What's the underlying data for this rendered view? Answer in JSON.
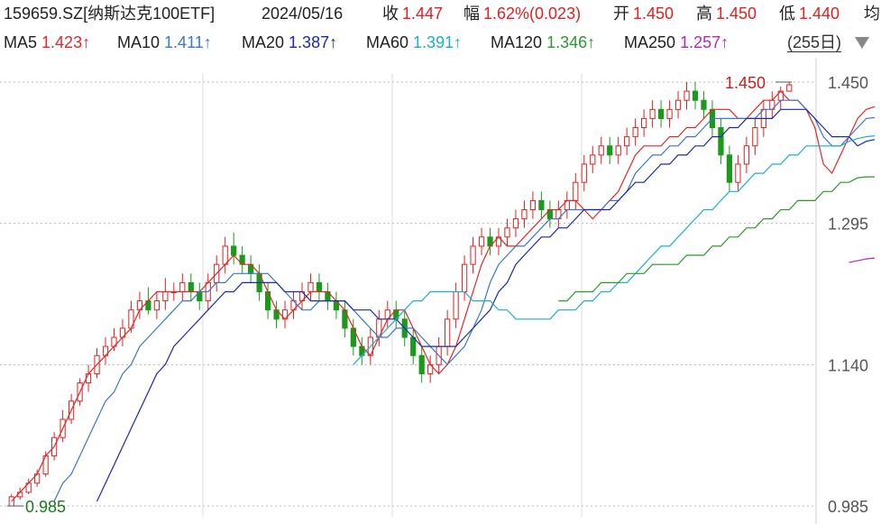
{
  "header": {
    "code": "159659.SZ[纳斯达克100ETF]",
    "date": "2024/05/16",
    "close_label": "收",
    "close_value": "1.447",
    "change_label": "幅",
    "change_value": "1.62%(0.023)",
    "open_label": "开",
    "open_value": "1.450",
    "high_label": "高",
    "high_value": "1.450",
    "low_label": "低",
    "low_value": "1.440",
    "avg_label": "均"
  },
  "ma_legend": [
    {
      "label": "MA5",
      "value": "1.423",
      "arrow": "↑",
      "color": "#e02828"
    },
    {
      "label": "MA10",
      "value": "1.411",
      "arrow": "↑",
      "color": "#3a78c8"
    },
    {
      "label": "MA20",
      "value": "1.387",
      "arrow": "↑",
      "color": "#1a2aa8"
    },
    {
      "label": "MA60",
      "value": "1.391",
      "arrow": "↑",
      "color": "#1ab0c8"
    },
    {
      "label": "MA120",
      "value": "1.346",
      "arrow": "↑",
      "color": "#2a9a2a"
    },
    {
      "label": "MA250",
      "value": "1.257",
      "arrow": "↑",
      "color": "#b02ab0"
    }
  ],
  "period_label": "(255日)",
  "colors": {
    "up": "#e02020",
    "down": "#1a9a1a",
    "grid": "#b8b8b8"
  },
  "chart_data": {
    "type": "candlestick",
    "y_ticks": [
      "1.450",
      "1.295",
      "1.140",
      "0.985"
    ],
    "ylim": [
      0.985,
      1.45
    ],
    "max_label": "1.450",
    "min_label": "0.985",
    "series": [
      {
        "name": "MA5",
        "values": [
          0.99,
          1.0,
          1.01,
          1.02,
          1.04,
          1.05,
          1.07,
          1.09,
          1.11,
          1.13,
          1.14,
          1.15,
          1.16,
          1.17,
          1.18,
          1.2,
          1.21,
          1.22,
          1.22,
          1.22,
          1.22,
          1.22,
          1.22,
          1.23,
          1.24,
          1.25,
          1.26,
          1.25,
          1.25,
          1.24,
          1.22,
          1.2,
          1.19,
          1.2,
          1.21,
          1.22,
          1.22,
          1.22,
          1.21,
          1.2,
          1.18,
          1.16,
          1.15,
          1.17,
          1.19,
          1.2,
          1.2,
          1.18,
          1.16,
          1.14,
          1.13,
          1.14,
          1.16,
          1.19,
          1.22,
          1.25,
          1.27,
          1.28,
          1.27,
          1.27,
          1.28,
          1.29,
          1.3,
          1.31,
          1.31,
          1.32,
          1.32,
          1.31,
          1.3,
          1.31,
          1.32,
          1.33,
          1.35,
          1.37,
          1.38,
          1.38,
          1.38,
          1.39,
          1.39,
          1.4,
          1.4,
          1.41,
          1.42,
          1.42,
          1.42,
          1.41,
          1.41,
          1.42,
          1.43,
          1.43,
          1.44,
          1.43,
          1.43,
          1.42,
          1.4,
          1.36,
          1.35,
          1.37,
          1.39,
          1.41,
          1.42,
          1.423
        ]
      },
      {
        "name": "MA10",
        "values": [
          null,
          null,
          null,
          null,
          null,
          0.99,
          1.01,
          1.02,
          1.04,
          1.06,
          1.08,
          1.1,
          1.11,
          1.13,
          1.14,
          1.16,
          1.17,
          1.18,
          1.19,
          1.2,
          1.21,
          1.21,
          1.22,
          1.22,
          1.23,
          1.23,
          1.24,
          1.24,
          1.24,
          1.24,
          1.24,
          1.23,
          1.22,
          1.21,
          1.2,
          1.2,
          1.21,
          1.21,
          1.21,
          1.21,
          1.2,
          1.19,
          1.18,
          1.17,
          1.17,
          1.18,
          1.18,
          1.18,
          1.17,
          1.16,
          1.15,
          1.14,
          1.15,
          1.16,
          1.18,
          1.2,
          1.23,
          1.25,
          1.26,
          1.27,
          1.27,
          1.28,
          1.29,
          1.3,
          1.3,
          1.31,
          1.31,
          1.31,
          1.31,
          1.31,
          1.32,
          1.32,
          1.33,
          1.35,
          1.36,
          1.37,
          1.37,
          1.38,
          1.38,
          1.39,
          1.39,
          1.4,
          1.41,
          1.41,
          1.41,
          1.41,
          1.41,
          1.41,
          1.42,
          1.42,
          1.43,
          1.43,
          1.43,
          1.42,
          1.41,
          1.39,
          1.38,
          1.38,
          1.39,
          1.4,
          1.41,
          1.411
        ]
      },
      {
        "name": "MA20",
        "values": [
          null,
          null,
          null,
          null,
          null,
          null,
          null,
          null,
          null,
          null,
          0.99,
          1.01,
          1.03,
          1.05,
          1.07,
          1.09,
          1.11,
          1.13,
          1.14,
          1.16,
          1.17,
          1.18,
          1.19,
          1.2,
          1.21,
          1.22,
          1.22,
          1.23,
          1.23,
          1.23,
          1.23,
          1.23,
          1.22,
          1.22,
          1.22,
          1.21,
          1.21,
          1.21,
          1.21,
          1.21,
          1.2,
          1.2,
          1.2,
          1.19,
          1.19,
          1.19,
          1.18,
          1.17,
          1.16,
          1.16,
          1.16,
          1.16,
          1.16,
          1.17,
          1.18,
          1.19,
          1.2,
          1.22,
          1.23,
          1.25,
          1.26,
          1.27,
          1.28,
          1.28,
          1.29,
          1.29,
          1.3,
          1.31,
          1.31,
          1.31,
          1.31,
          1.32,
          1.33,
          1.34,
          1.34,
          1.35,
          1.36,
          1.36,
          1.37,
          1.37,
          1.38,
          1.38,
          1.39,
          1.39,
          1.4,
          1.4,
          1.41,
          1.41,
          1.41,
          1.41,
          1.42,
          1.42,
          1.42,
          1.42,
          1.41,
          1.4,
          1.39,
          1.39,
          1.39,
          1.38,
          1.385,
          1.387
        ]
      },
      {
        "name": "MA60",
        "values": [
          null,
          null,
          null,
          null,
          null,
          null,
          null,
          null,
          null,
          null,
          null,
          null,
          null,
          null,
          null,
          null,
          null,
          null,
          null,
          null,
          null,
          null,
          null,
          null,
          null,
          null,
          null,
          null,
          null,
          null,
          null,
          null,
          null,
          null,
          null,
          null,
          null,
          null,
          null,
          null,
          1.14,
          1.15,
          1.16,
          1.17,
          1.18,
          1.19,
          1.2,
          1.21,
          1.21,
          1.22,
          1.22,
          1.22,
          1.22,
          1.22,
          1.21,
          1.21,
          1.21,
          1.2,
          1.2,
          1.19,
          1.19,
          1.19,
          1.19,
          1.19,
          1.2,
          1.2,
          1.2,
          1.21,
          1.21,
          1.22,
          1.22,
          1.23,
          1.23,
          1.24,
          1.25,
          1.26,
          1.27,
          1.27,
          1.28,
          1.29,
          1.3,
          1.31,
          1.31,
          1.32,
          1.33,
          1.33,
          1.34,
          1.35,
          1.35,
          1.36,
          1.36,
          1.37,
          1.37,
          1.38,
          1.38,
          1.38,
          1.38,
          1.38,
          1.385,
          1.388,
          1.39,
          1.391
        ]
      },
      {
        "name": "MA120",
        "values": [
          null,
          null,
          null,
          null,
          null,
          null,
          null,
          null,
          null,
          null,
          null,
          null,
          null,
          null,
          null,
          null,
          null,
          null,
          null,
          null,
          null,
          null,
          null,
          null,
          null,
          null,
          null,
          null,
          null,
          null,
          null,
          null,
          null,
          null,
          null,
          null,
          null,
          null,
          null,
          null,
          null,
          null,
          null,
          null,
          null,
          null,
          null,
          null,
          null,
          null,
          null,
          null,
          null,
          null,
          null,
          null,
          null,
          null,
          null,
          null,
          null,
          null,
          null,
          null,
          1.21,
          1.21,
          1.22,
          1.22,
          1.22,
          1.23,
          1.23,
          1.23,
          1.24,
          1.24,
          1.24,
          1.25,
          1.25,
          1.25,
          1.25,
          1.26,
          1.26,
          1.26,
          1.27,
          1.27,
          1.28,
          1.28,
          1.29,
          1.29,
          1.3,
          1.3,
          1.31,
          1.31,
          1.32,
          1.32,
          1.32,
          1.33,
          1.33,
          1.34,
          1.34,
          1.345,
          1.346,
          1.346
        ]
      },
      {
        "name": "MA250",
        "values": [
          null,
          null,
          null,
          null,
          null,
          null,
          null,
          null,
          null,
          null,
          null,
          null,
          null,
          null,
          null,
          null,
          null,
          null,
          null,
          null,
          null,
          null,
          null,
          null,
          null,
          null,
          null,
          null,
          null,
          null,
          null,
          null,
          null,
          null,
          null,
          null,
          null,
          null,
          null,
          null,
          null,
          null,
          null,
          null,
          null,
          null,
          null,
          null,
          null,
          null,
          null,
          null,
          null,
          null,
          null,
          null,
          null,
          null,
          null,
          null,
          null,
          null,
          null,
          null,
          null,
          null,
          null,
          null,
          null,
          null,
          null,
          null,
          null,
          null,
          null,
          null,
          null,
          null,
          null,
          null,
          null,
          null,
          null,
          null,
          null,
          null,
          null,
          null,
          null,
          null,
          null,
          null,
          null,
          null,
          null,
          null,
          null,
          null,
          1.252,
          1.254,
          1.256,
          1.257
        ]
      }
    ],
    "candles": [
      [
        0.985,
        0.995,
        0.985,
        0.998
      ],
      [
        0.995,
        1.0,
        0.992,
        1.005
      ],
      [
        1.0,
        1.01,
        0.998,
        1.015
      ],
      [
        1.01,
        1.02,
        1.006,
        1.025
      ],
      [
        1.02,
        1.04,
        1.017,
        1.045
      ],
      [
        1.04,
        1.06,
        1.035,
        1.066
      ],
      [
        1.06,
        1.08,
        1.055,
        1.09
      ],
      [
        1.08,
        1.1,
        1.075,
        1.108
      ],
      [
        1.1,
        1.12,
        1.095,
        1.125
      ],
      [
        1.12,
        1.13,
        1.11,
        1.14
      ],
      [
        1.13,
        1.15,
        1.125,
        1.158
      ],
      [
        1.15,
        1.16,
        1.14,
        1.17
      ],
      [
        1.16,
        1.17,
        1.155,
        1.18
      ],
      [
        1.17,
        1.18,
        1.16,
        1.19
      ],
      [
        1.18,
        1.2,
        1.175,
        1.21
      ],
      [
        1.2,
        1.21,
        1.19,
        1.22
      ],
      [
        1.21,
        1.2,
        1.195,
        1.225
      ],
      [
        1.2,
        1.21,
        1.19,
        1.22
      ],
      [
        1.21,
        1.22,
        1.2,
        1.235
      ],
      [
        1.22,
        1.22,
        1.21,
        1.23
      ],
      [
        1.22,
        1.23,
        1.21,
        1.24
      ],
      [
        1.23,
        1.22,
        1.21,
        1.24
      ],
      [
        1.22,
        1.21,
        1.2,
        1.23
      ],
      [
        1.21,
        1.23,
        1.2,
        1.24
      ],
      [
        1.23,
        1.25,
        1.22,
        1.26
      ],
      [
        1.25,
        1.27,
        1.24,
        1.28
      ],
      [
        1.27,
        1.26,
        1.25,
        1.285
      ],
      [
        1.26,
        1.25,
        1.24,
        1.27
      ],
      [
        1.25,
        1.24,
        1.23,
        1.26
      ],
      [
        1.24,
        1.22,
        1.21,
        1.25
      ],
      [
        1.22,
        1.2,
        1.19,
        1.23
      ],
      [
        1.2,
        1.19,
        1.18,
        1.21
      ],
      [
        1.19,
        1.2,
        1.18,
        1.21
      ],
      [
        1.2,
        1.21,
        1.19,
        1.22
      ],
      [
        1.21,
        1.22,
        1.2,
        1.23
      ],
      [
        1.22,
        1.23,
        1.21,
        1.24
      ],
      [
        1.23,
        1.22,
        1.21,
        1.24
      ],
      [
        1.22,
        1.21,
        1.2,
        1.23
      ],
      [
        1.21,
        1.2,
        1.19,
        1.22
      ],
      [
        1.2,
        1.18,
        1.17,
        1.21
      ],
      [
        1.18,
        1.16,
        1.15,
        1.19
      ],
      [
        1.16,
        1.15,
        1.14,
        1.17
      ],
      [
        1.15,
        1.17,
        1.14,
        1.18
      ],
      [
        1.17,
        1.19,
        1.16,
        1.2
      ],
      [
        1.19,
        1.2,
        1.18,
        1.21
      ],
      [
        1.2,
        1.19,
        1.18,
        1.21
      ],
      [
        1.19,
        1.17,
        1.16,
        1.2
      ],
      [
        1.17,
        1.15,
        1.14,
        1.18
      ],
      [
        1.15,
        1.13,
        1.12,
        1.16
      ],
      [
        1.13,
        1.14,
        1.12,
        1.15
      ],
      [
        1.14,
        1.16,
        1.13,
        1.17
      ],
      [
        1.16,
        1.19,
        1.15,
        1.2
      ],
      [
        1.19,
        1.22,
        1.18,
        1.23
      ],
      [
        1.22,
        1.25,
        1.21,
        1.26
      ],
      [
        1.25,
        1.27,
        1.24,
        1.28
      ],
      [
        1.27,
        1.28,
        1.26,
        1.29
      ],
      [
        1.28,
        1.27,
        1.26,
        1.29
      ],
      [
        1.27,
        1.28,
        1.26,
        1.29
      ],
      [
        1.28,
        1.29,
        1.27,
        1.3
      ],
      [
        1.29,
        1.3,
        1.28,
        1.31
      ],
      [
        1.3,
        1.31,
        1.29,
        1.32
      ],
      [
        1.31,
        1.32,
        1.3,
        1.33
      ],
      [
        1.32,
        1.31,
        1.3,
        1.33
      ],
      [
        1.31,
        1.3,
        1.29,
        1.32
      ],
      [
        1.3,
        1.31,
        1.29,
        1.32
      ],
      [
        1.31,
        1.32,
        1.3,
        1.33
      ],
      [
        1.32,
        1.34,
        1.31,
        1.35
      ],
      [
        1.34,
        1.36,
        1.33,
        1.37
      ],
      [
        1.36,
        1.37,
        1.35,
        1.38
      ],
      [
        1.37,
        1.38,
        1.36,
        1.39
      ],
      [
        1.38,
        1.37,
        1.36,
        1.39
      ],
      [
        1.37,
        1.38,
        1.36,
        1.39
      ],
      [
        1.38,
        1.39,
        1.37,
        1.4
      ],
      [
        1.39,
        1.4,
        1.38,
        1.41
      ],
      [
        1.4,
        1.41,
        1.39,
        1.42
      ],
      [
        1.41,
        1.42,
        1.4,
        1.43
      ],
      [
        1.42,
        1.41,
        1.4,
        1.43
      ],
      [
        1.41,
        1.42,
        1.4,
        1.43
      ],
      [
        1.42,
        1.43,
        1.41,
        1.44
      ],
      [
        1.43,
        1.44,
        1.42,
        1.45
      ],
      [
        1.44,
        1.43,
        1.42,
        1.45
      ],
      [
        1.43,
        1.42,
        1.41,
        1.44
      ],
      [
        1.42,
        1.4,
        1.39,
        1.43
      ],
      [
        1.4,
        1.37,
        1.36,
        1.41
      ],
      [
        1.37,
        1.34,
        1.33,
        1.38
      ],
      [
        1.34,
        1.36,
        1.33,
        1.37
      ],
      [
        1.36,
        1.38,
        1.35,
        1.39
      ],
      [
        1.38,
        1.4,
        1.37,
        1.41
      ],
      [
        1.4,
        1.42,
        1.39,
        1.43
      ],
      [
        1.42,
        1.43,
        1.41,
        1.44
      ],
      [
        1.43,
        1.44,
        1.42,
        1.445
      ],
      [
        1.44,
        1.447,
        1.44,
        1.45
      ]
    ]
  }
}
